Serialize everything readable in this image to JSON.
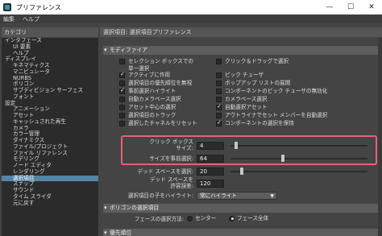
{
  "window": {
    "title": "プリファレンス",
    "minimize": "—",
    "maximize": "☐",
    "close": "✕"
  },
  "menu": [
    "編集",
    "ヘルプ"
  ],
  "categories": {
    "header": "カテゴリ",
    "items": [
      {
        "label": "インタフェース",
        "level": 0
      },
      {
        "label": "UI 要素",
        "level": 1
      },
      {
        "label": "ヘルプ",
        "level": 1
      },
      {
        "label": "ディスプレイ",
        "level": 0
      },
      {
        "label": "キネマティクス",
        "level": 1
      },
      {
        "label": "マニピュレータ",
        "level": 1
      },
      {
        "label": "NURBS",
        "level": 1
      },
      {
        "label": "ポリゴン",
        "level": 1
      },
      {
        "label": "サブディビジョン サーフェス",
        "level": 1
      },
      {
        "label": "フォント",
        "level": 1
      },
      {
        "label": "設定",
        "level": 0
      },
      {
        "label": "アニメーション",
        "level": 1
      },
      {
        "label": "アセット",
        "level": 1
      },
      {
        "label": "キャッシュされた再生",
        "level": 1
      },
      {
        "label": "カメラ",
        "level": 1
      },
      {
        "label": "カラー管理",
        "level": 1
      },
      {
        "label": "ダイナミクス",
        "level": 1
      },
      {
        "label": "ファイル/プロジェクト",
        "level": 1
      },
      {
        "label": "ファイル リファレンス",
        "level": 1
      },
      {
        "label": "モデリング",
        "level": 1
      },
      {
        "label": "ノード エディタ",
        "level": 1
      },
      {
        "label": "レンダリング",
        "level": 1
      },
      {
        "label": "選択項目",
        "level": 1,
        "selected": true
      },
      {
        "label": "スナップ",
        "level": 1
      },
      {
        "label": "サウンド",
        "level": 1
      },
      {
        "label": "タイム スライダ",
        "level": 1
      },
      {
        "label": "元に戻す",
        "level": 1
      }
    ]
  },
  "pane": {
    "header": "選択項目: 選択項目プリファレンス",
    "modifiers_section": "モディファイア",
    "left_options": [
      {
        "label": "セレクション ボックスでの\n単一選択",
        "checked": false
      },
      {
        "label": "アクティブに作用",
        "checked": true
      },
      {
        "label": "選択項目の優先順位を無視",
        "checked": false
      },
      {
        "label": "事前選択ハイライト",
        "checked": true
      },
      {
        "label": "自動カメラベース選択",
        "checked": false
      },
      {
        "label": "アセット中心の選択",
        "checked": false
      },
      {
        "label": "選択項目のトラック",
        "checked": false
      },
      {
        "label": "選択したチャネルをリセット",
        "checked": false
      }
    ],
    "right_options": [
      {
        "label": "クリック＆ドラッグで選択",
        "checked": false
      },
      {
        "label": "ピック チューザ",
        "checked": false
      },
      {
        "label": "ポップアップ リストの展開",
        "checked": false
      },
      {
        "label": "コンポーネントのピック チューザの無効化",
        "checked": false
      },
      {
        "label": "カメラベース選択",
        "checked": false
      },
      {
        "label": "自動選択アセット",
        "checked": true
      },
      {
        "label": "アウトライナでセット メンバーを自動選択",
        "checked": false
      },
      {
        "label": "コンポーネントの選択を保持",
        "checked": true
      }
    ],
    "click_box_label_1": "クリック ボックス",
    "click_box_label_2": "サイズ:",
    "click_box_value": "4",
    "click_box_level": 0.04,
    "preselect_label": "サイズを事前選択:",
    "preselect_value": "64",
    "preselect_level": 0.38,
    "dead_space_label": "デッド スペースを選択:",
    "dead_space_value": "20",
    "dead_space_level": 0.08,
    "dead_space_tol_label_1": "デッド スペースを",
    "dead_space_tol_label_2": "許容誤差:",
    "dead_space_tol_value": "120",
    "child_highlight_label": "選択項目の子をハイライト:",
    "child_highlight_value": "常にハイライト",
    "polygon_section": "ポリゴンの選択項目",
    "face_select_label": "フェースの選択方法:",
    "face_select_center": "センター",
    "face_select_whole": "フェース全体",
    "face_select_selected": "whole",
    "priority_section": "優先順位"
  },
  "colors": {
    "selected": "#5285a6",
    "highlight": "#e8607a",
    "panel": "#444444",
    "list": "#2b2b2b"
  }
}
